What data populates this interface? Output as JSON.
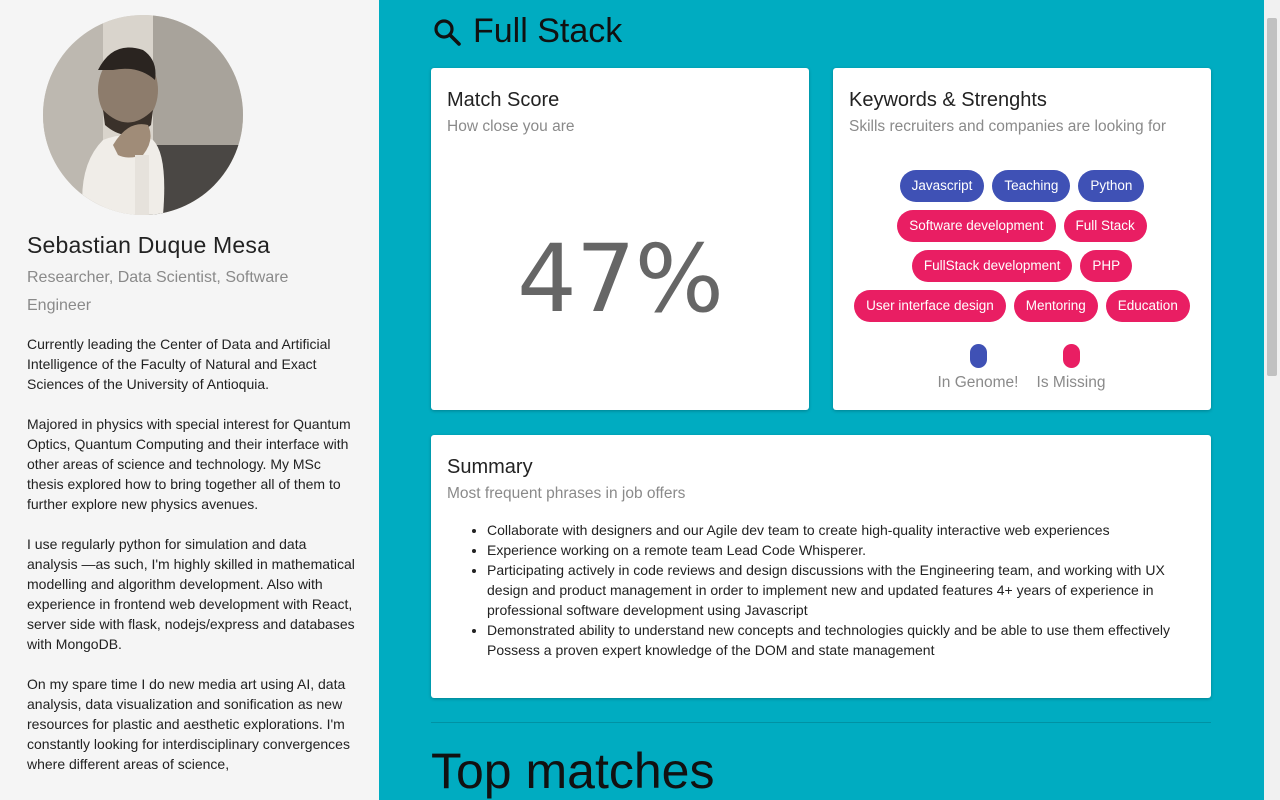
{
  "profile": {
    "name": "Sebastian Duque Mesa",
    "roles": "Researcher, Data Scientist, Software Engineer",
    "bio": [
      "Currently leading the Center of Data and Artificial Intelligence of the Faculty of Natural and Exact Sciences of the University of Antioquia.",
      "Majored in physics with special interest for Quantum Optics, Quantum Computing and their interface with other areas of science and technology. My MSc thesis explored how to bring together all of them to further explore new physics avenues.",
      "I use regularly python for simulation and data analysis —as such, I'm highly skilled in mathematical modelling and algorithm development. Also with experience in frontend web development with React, server side with flask, nodejs/express and databases with MongoDB.",
      "On my spare time I do new media art using AI, data analysis, data visualization and sonification as new resources for plastic and aesthetic explorations. I'm constantly looking for interdisciplinary convergences where different areas of science,"
    ]
  },
  "search": {
    "title": "Full Stack",
    "icon": "search-icon"
  },
  "match": {
    "title": "Match Score",
    "subtitle": "How close you are",
    "value": "47%"
  },
  "keywords": {
    "title": "Keywords & Strenghts",
    "subtitle": "Skills recruiters and companies are looking for",
    "rows": [
      [
        {
          "label": "Javascript",
          "status": "in"
        },
        {
          "label": "Teaching",
          "status": "in"
        },
        {
          "label": "Python",
          "status": "in"
        }
      ],
      [
        {
          "label": "Software development",
          "status": "miss"
        },
        {
          "label": "Full Stack",
          "status": "miss"
        }
      ],
      [
        {
          "label": "FullStack development",
          "status": "miss"
        },
        {
          "label": "PHP",
          "status": "miss"
        }
      ],
      [
        {
          "label": "User interface design",
          "status": "miss"
        },
        {
          "label": "Mentoring",
          "status": "miss"
        },
        {
          "label": "Education",
          "status": "miss"
        }
      ]
    ],
    "legend": {
      "in_label": "In Genome!",
      "miss_label": "Is Missing"
    },
    "colors": {
      "in": "#3f51b5",
      "miss": "#e91e63"
    }
  },
  "summary": {
    "title": "Summary",
    "subtitle": "Most frequent phrases in job offers",
    "items": [
      "Collaborate with designers and our Agile dev team to create high-quality interactive web experiences",
      "Experience working on a remote team Lead Code Whisperer.",
      "Participating actively in code reviews and design discussions with the Engineering team, and working with UX design and product management in order to implement new and updated features 4+ years of experience in professional software development using Javascript",
      "Demonstrated ability to understand new concepts and technologies quickly and be able to use them effectively Possess a proven expert knowledge of the DOM and state management"
    ]
  },
  "top_matches": {
    "title": "Top matches"
  },
  "theme": {
    "background": "#00acc1",
    "sidebar": "#f5f5f5"
  }
}
